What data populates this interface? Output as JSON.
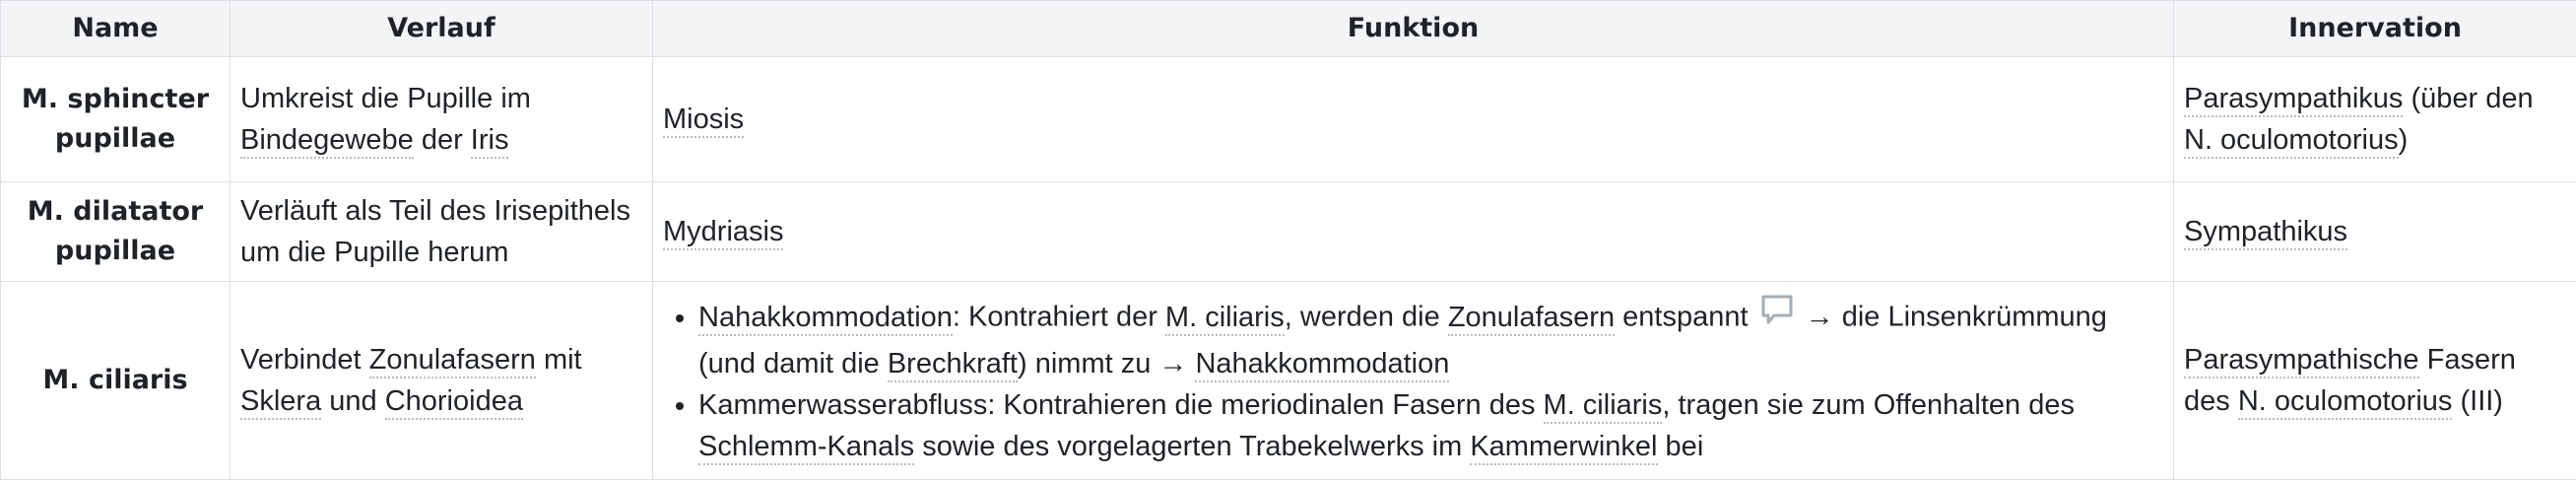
{
  "headers": {
    "name": "Name",
    "verlauf": "Verlauf",
    "funktion": "Funktion",
    "innervation": "Innervation"
  },
  "rows": [
    {
      "name_line1": "M. sphincter",
      "name_line2": "pupillae",
      "verlauf": {
        "t1": "Umkreist die Pupille im ",
        "l1": "Bindegewebe",
        "t2": " der ",
        "l2": "Iris"
      },
      "funktion": {
        "l1": "Miosis"
      },
      "innervation": {
        "l1": "Parasympathikus",
        "t1": " (über den ",
        "l2": "N. oculomotorius",
        "t2": ")"
      }
    },
    {
      "name_line1": "M. dilatator",
      "name_line2": "pupillae",
      "verlauf": {
        "line1": "Verläuft als Teil des Irisepithels",
        "line2": "um die Pupille herum"
      },
      "funktion": {
        "l1": "Mydriasis"
      },
      "innervation": {
        "l1": "Sympathikus"
      }
    },
    {
      "name": "M. ciliaris",
      "verlauf": {
        "t1": "Verbindet ",
        "l1": "Zonulafasern",
        "t2": " mit ",
        "l2": "Sklera",
        "t3": " und ",
        "l3": "Chorioidea"
      },
      "funktion": {
        "b1": {
          "l1": "Nahakkommodation",
          "t1": ": Kontrahiert der ",
          "l2": "M. ciliaris",
          "t2": ", werden die ",
          "l3": "Zonulafasern",
          "t3": " entspannt ",
          "icon": "comment-icon",
          "t4": " → die Linsenkrümmung (und damit die ",
          "l4": "Brechkraft",
          "t5": ") nimmt zu → ",
          "l5": "Nahakkommodation"
        },
        "b2": {
          "t1": "Kammerwasserabfluss: Kontrahieren die meriodinalen Fasern des ",
          "l1": "M. ciliaris",
          "t2": ", tragen sie zum Offenhalten des ",
          "l2": "Schlemm-Kanals",
          "t3": " sowie des vorgelagerten Trabekelwerks im ",
          "l3": "Kammerwinkel",
          "t4": " bei"
        }
      },
      "innervation": {
        "l1": "Parasympathische",
        "t1": " Fasern des ",
        "l2": "N. oculomotorius",
        "t2": " (III)"
      }
    }
  ],
  "colors": {
    "header_bg": "#f3f4f5",
    "border": "#dcdfe3",
    "link_underline": "#b7bcc2",
    "icon": "#a4adb4",
    "text": "#1f2328"
  }
}
